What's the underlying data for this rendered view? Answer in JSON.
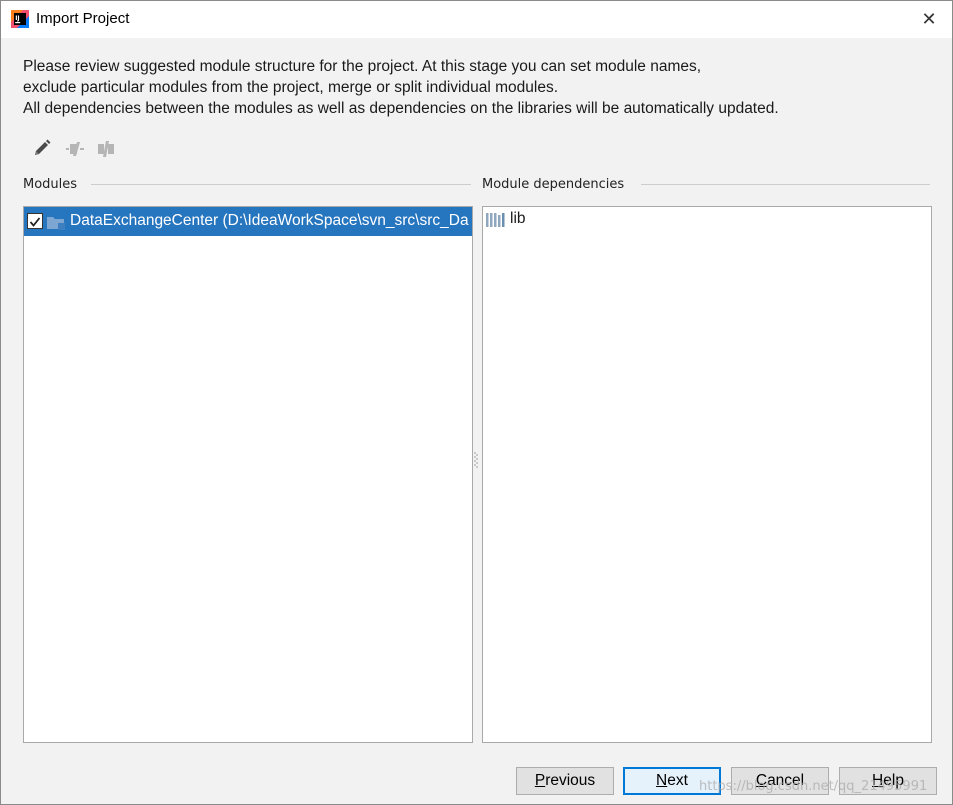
{
  "window": {
    "title": "Import Project",
    "close_symbol": "✕"
  },
  "description": {
    "line1": "Please review suggested module structure for the project. At this stage you can set module names,",
    "line2": "exclude particular modules from the project, merge or split individual modules.",
    "line3": "All dependencies between the modules as well as dependencies on the libraries will be automatically updated."
  },
  "toolbar": {
    "icons": [
      "edit-icon",
      "merge-modules-icon",
      "split-module-icon"
    ]
  },
  "modules": {
    "label": "Modules",
    "items": [
      {
        "name": "DataExchangeCenter (D:\\IdeaWorkSpace\\svn_src\\src_Da",
        "checked": true,
        "selected": true
      }
    ]
  },
  "dependencies": {
    "label": "Module dependencies",
    "items": [
      {
        "name": "lib",
        "icon": "library-icon"
      }
    ]
  },
  "buttons": {
    "previous": {
      "mnemonic": "P",
      "rest": "revious"
    },
    "next": {
      "mnemonic": "N",
      "rest": "ext"
    },
    "cancel": {
      "mnemonic": "C",
      "rest": "ancel"
    },
    "help": {
      "mnemonic": "H",
      "rest": "elp"
    }
  },
  "watermark": "https://blog.csdn.net/qq_21495991",
  "colors": {
    "selection": "#2675bf",
    "default_button_border": "#0078d7",
    "folder_icon": "#6b8fb8"
  }
}
